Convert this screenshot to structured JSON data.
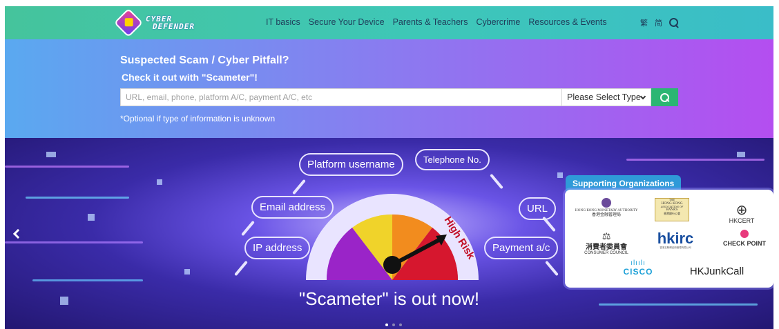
{
  "header": {
    "logo_line1": "CYBER",
    "logo_line2": "DEFENDER",
    "nav": [
      "IT basics",
      "Secure Your Device",
      "Parents & Teachers",
      "Cybercrime",
      "Resources & Events"
    ],
    "lang_trad": "繁",
    "lang_simp": "简"
  },
  "scameter": {
    "title": "Suspected Scam / Cyber Pitfall?",
    "subtitle": "Check it out with \"Scameter\"!",
    "input_placeholder": "URL, email, phone, platform A/C, payment A/C, etc",
    "select_value": "Please Select Type",
    "note": "*Optional if type of information is unknown"
  },
  "banner": {
    "labels": {
      "platform": "Platform username",
      "telephone": "Telephone No.",
      "email": "Email address",
      "url": "URL",
      "ip": "IP address",
      "payment": "Payment a/c"
    },
    "risk": "High Risk",
    "headline": "\"Scameter\" is out now!",
    "slides": 3,
    "active_slide": 1
  },
  "supporting": {
    "heading": "Supporting Organizations",
    "hkma": "HONG KONG MONETARY AUTHORITY",
    "hkma_cn": "香港金融管理局",
    "hkab_1": "THE",
    "hkab_2": "HONG KONG",
    "hkab_3": "ASSOCIATION OF",
    "hkab_4": "BANKS",
    "hkab_cn": "香港銀行公會",
    "hkcert": "HKCERT",
    "consumer_cn": "消費者委員會",
    "consumer_en": "CONSUMER COUNCIL",
    "hkirc": "hkirc",
    "hkirc_sub": "香港互聯網註冊管理有限公司",
    "checkpoint": "CHECK POINT",
    "cisco": "CISCO",
    "junkcall": "HKJunkCall"
  },
  "colors": {
    "nav_bg": "#45c49c",
    "search_button": "#2bb673",
    "supporting_head": "#2f9ad8"
  }
}
